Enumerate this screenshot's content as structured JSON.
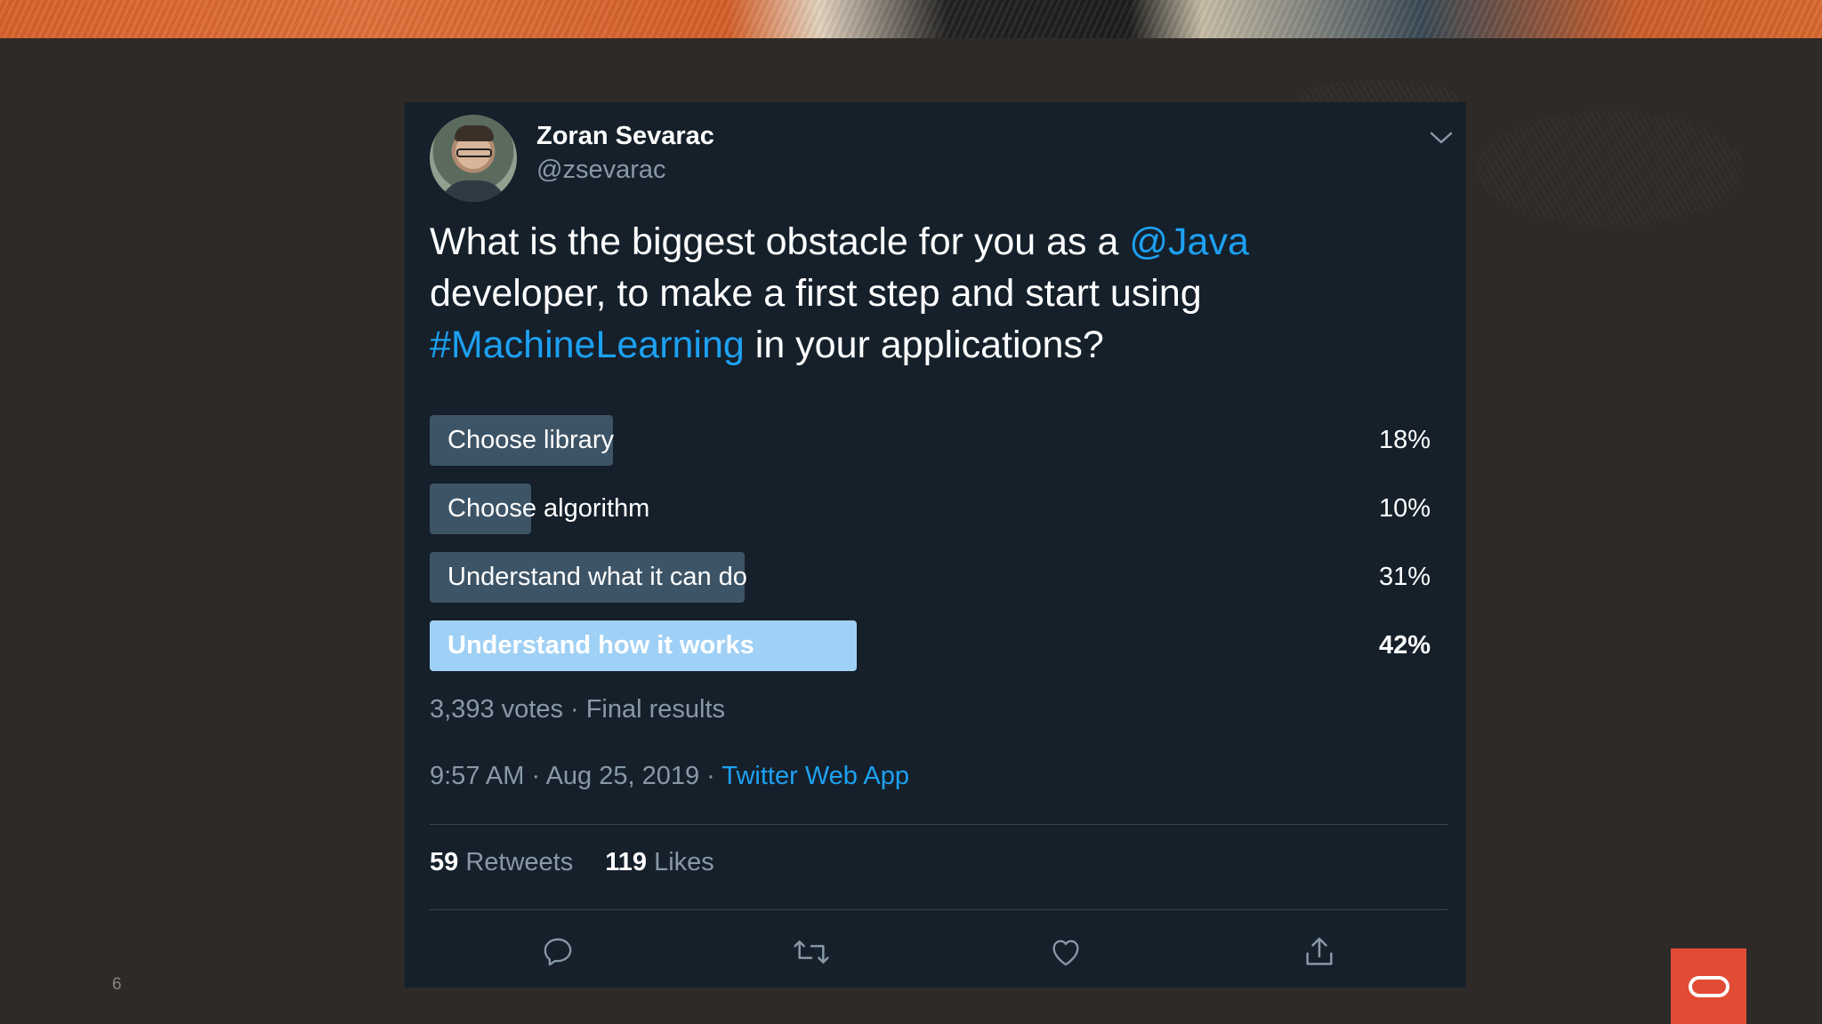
{
  "tweet": {
    "user_name": "Zoran Sevarac",
    "user_handle": "@zsevarac",
    "text_part1": "What is the biggest obstacle for you as a ",
    "mention": "@Java",
    "text_part2": " developer, to make a first step and start using ",
    "hashtag": "#MachineLearning",
    "text_part3": " in your applications?",
    "poll": {
      "options": [
        {
          "label": "Choose library",
          "percent_text": "18%",
          "percent": 18,
          "winner": false
        },
        {
          "label": "Choose algorithm",
          "percent_text": "10%",
          "percent": 10,
          "winner": false
        },
        {
          "label": "Understand what it can do",
          "percent_text": "31%",
          "percent": 31,
          "winner": false
        },
        {
          "label": "Understand how it works",
          "percent_text": "42%",
          "percent": 42,
          "winner": true
        }
      ],
      "summary": "3,393 votes · Final results"
    },
    "time": "9:57 AM · Aug 25, 2019 · ",
    "source": "Twitter Web App",
    "retweets_count": "59",
    "retweets_label": "Retweets",
    "likes_count": "119",
    "likes_label": "Likes"
  },
  "page_number": "6",
  "colors": {
    "background": "#2e2a27",
    "card": "#15202b",
    "link": "#1da1f2",
    "poll_bar": "#3d5466",
    "poll_winner": "#9fd0f5",
    "muted": "#8899a6",
    "brand": "#e24b35"
  },
  "icons": [
    "chevron-down-icon",
    "reply-icon",
    "retweet-icon",
    "like-icon",
    "share-icon",
    "oracle-logo-icon"
  ]
}
